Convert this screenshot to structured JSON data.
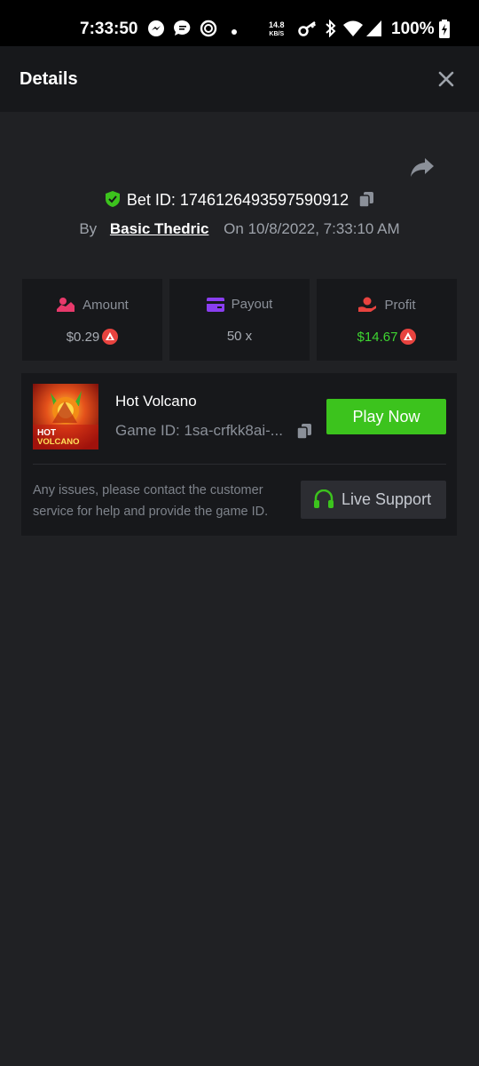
{
  "status_bar": {
    "time": "7:33:50",
    "speed_value": "14.8",
    "speed_unit": "KB/S",
    "battery": "100%"
  },
  "header": {
    "title": "Details"
  },
  "bet": {
    "id_label": "Bet ID:",
    "id_value": "1746126493597590912",
    "by_label": "By",
    "user": "Basic Thedric",
    "on_label": "On",
    "timestamp": "10/8/2022, 7:33:10 AM"
  },
  "stats": {
    "amount": {
      "label": "Amount",
      "value": "$0.29"
    },
    "payout": {
      "label": "Payout",
      "value": "50 x"
    },
    "profit": {
      "label": "Profit",
      "value": "$14.67"
    }
  },
  "game": {
    "name": "Hot Volcano",
    "id_text": "Game ID: 1sa-crfkk8ai-...",
    "thumb_line1": "HOT",
    "thumb_line2": "VOLCANO",
    "play_label": "Play Now",
    "help_text": "Any issues, please contact the customer service for help and provide the game ID.",
    "support_label": "Live Support"
  },
  "colors": {
    "background": "#202124",
    "card": "#17181b",
    "accent_green": "#3cc31d",
    "profit_green": "#3ed431",
    "coin_red": "#e8433f"
  },
  "icons": [
    "messenger-icon",
    "chat-icon",
    "sync-icon",
    "key-icon",
    "bluetooth-icon",
    "wifi-icon",
    "signal-icon",
    "battery-icon",
    "close-icon",
    "share-icon",
    "shield-check-icon",
    "copy-icon",
    "coin-icon",
    "support-headset-icon"
  ]
}
